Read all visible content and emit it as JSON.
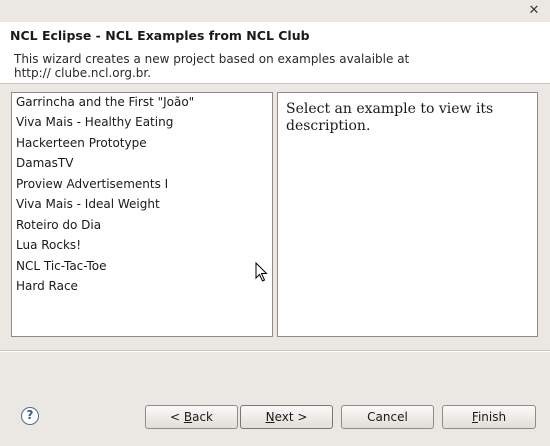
{
  "window": {
    "close_glyph": "✕"
  },
  "header": {
    "title": "NCL Eclipse - NCL Examples from NCL Club",
    "description": "This wizard creates a new project based on examples avalaible at http:// clube.ncl.org.br."
  },
  "examples": [
    "Garrincha and the First \"João\"",
    "Viva Mais - Healthy Eating",
    "Hackerteen Prototype",
    "DamasTV",
    "Proview Advertisements I",
    "Viva Mais - Ideal Weight",
    "Roteiro do Dia",
    "Lua Rocks!",
    "NCL Tic-Tac-Toe",
    "Hard Race"
  ],
  "description_panel": {
    "text": "Select an example to view its description."
  },
  "buttons": {
    "help": "?",
    "back": {
      "prefix": "< ",
      "mnemonic": "B",
      "rest": "ack"
    },
    "next": {
      "mnemonic": "N",
      "rest": "ext >"
    },
    "cancel": "Cancel",
    "finish": {
      "mnemonic": "F",
      "rest": "inish"
    }
  }
}
